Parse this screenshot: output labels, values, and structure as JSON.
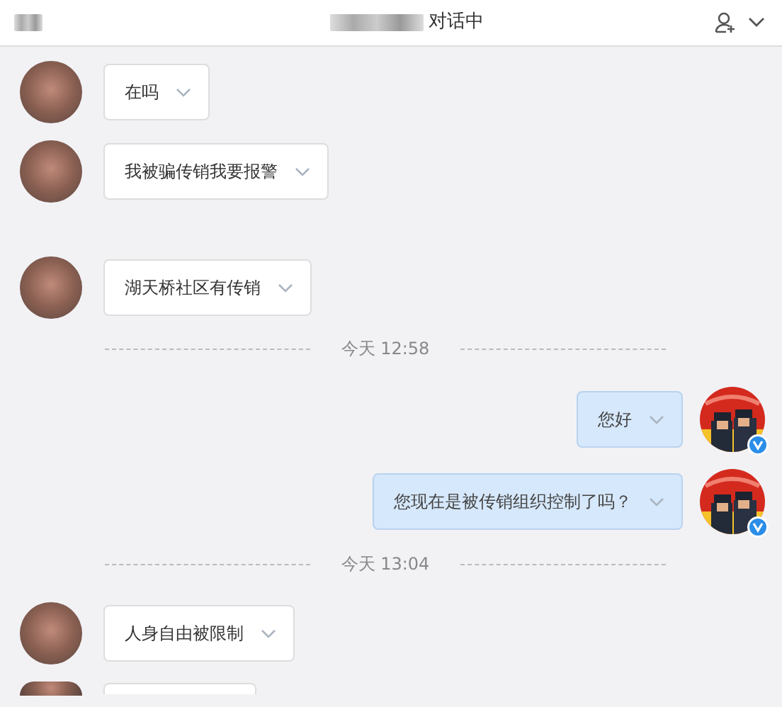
{
  "header": {
    "status": "对话中"
  },
  "messages": [
    {
      "kind": "incoming",
      "text": "在吗"
    },
    {
      "kind": "incoming",
      "text": "我被骗传销我要报警"
    },
    {
      "kind": "incoming",
      "text": "湖天桥社区有传销",
      "spaced": true
    },
    {
      "kind": "time",
      "text": "今天 12:58"
    },
    {
      "kind": "outgoing",
      "text": "您好",
      "verified": true
    },
    {
      "kind": "outgoing",
      "text": "您现在是被传销组织控制了吗？",
      "verified": true
    },
    {
      "kind": "time",
      "text": "今天 13:04"
    },
    {
      "kind": "incoming",
      "text": "人身自由被限制"
    },
    {
      "kind": "incoming_cut"
    }
  ]
}
